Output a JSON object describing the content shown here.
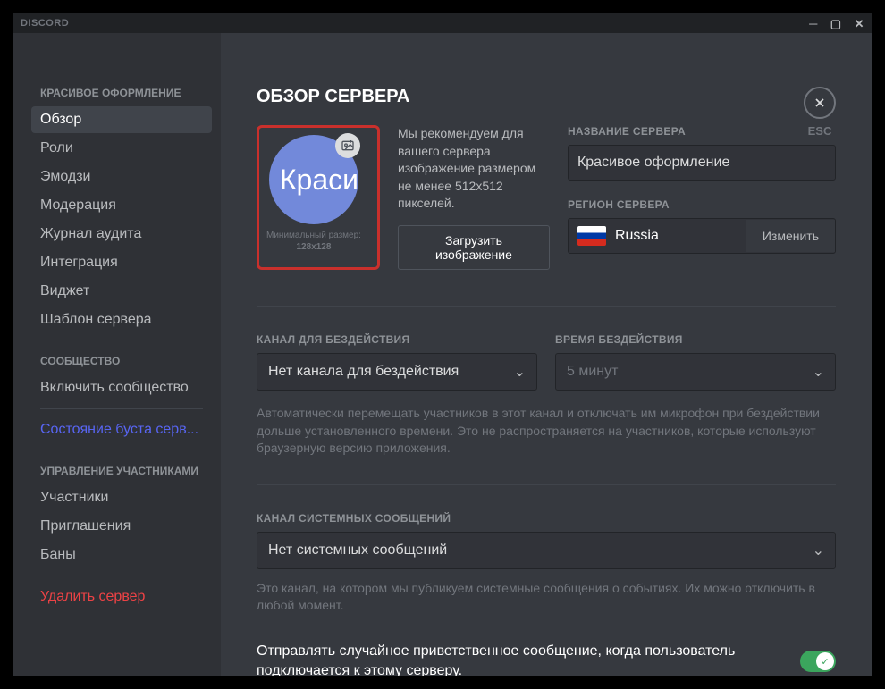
{
  "titlebar": {
    "app_name": "DISCORD"
  },
  "esc": {
    "label": "ESC"
  },
  "sidebar": {
    "cat1": "КРАСИВОЕ ОФОРМЛЕНИЕ",
    "items1": {
      "overview": "Обзор",
      "roles": "Роли",
      "emoji": "Эмодзи",
      "moderation": "Модерация",
      "audit": "Журнал аудита",
      "integration": "Интеграция",
      "widget": "Виджет",
      "template": "Шаблон сервера"
    },
    "cat2": "СООБЩЕСТВО",
    "items2": {
      "enable_community": "Включить сообщество",
      "boost": "Состояние буста серв..."
    },
    "cat3": "УПРАВЛЕНИЕ УЧАСТНИКАМИ",
    "items3": {
      "members": "Участники",
      "invites": "Приглашения",
      "bans": "Баны"
    },
    "delete": "Удалить сервер"
  },
  "main": {
    "title": "ОБЗОР СЕРВЕРА",
    "avatar_text": "Краси",
    "min_size_label": "Минимальный размер:",
    "min_size_value": "128x128",
    "hint": "Мы рекомендуем для вашего сервера изображение размером не менее 512x512 пикселей.",
    "upload_btn": "Загрузить изображение",
    "server_name_label": "НАЗВАНИЕ СЕРВЕРА",
    "server_name_value": "Красивое оформление",
    "region_label": "РЕГИОН СЕРВЕРА",
    "region_value": "Russia",
    "region_change": "Изменить",
    "afk_channel_label": "КАНАЛ ДЛЯ БЕЗДЕЙСТВИЯ",
    "afk_channel_value": "Нет канала для бездействия",
    "afk_timeout_label": "ВРЕМЯ БЕЗДЕЙСТВИЯ",
    "afk_timeout_value": "5 минут",
    "afk_help": "Автоматически перемещать участников в этот канал и отключать им микрофон при бездействии дольше установленного времени. Это не распространяется на участников, которые используют браузерную версию приложения.",
    "system_channel_label": "КАНАЛ СИСТЕМНЫХ СООБЩЕНИЙ",
    "system_channel_value": "Нет системных сообщений",
    "system_help": "Это канал, на котором мы публикуем системные сообщения о событиях. Их можно отключить в любой момент.",
    "welcome_toggle_label": "Отправлять случайное приветственное сообщение, когда пользователь подключается к этому серверу."
  }
}
